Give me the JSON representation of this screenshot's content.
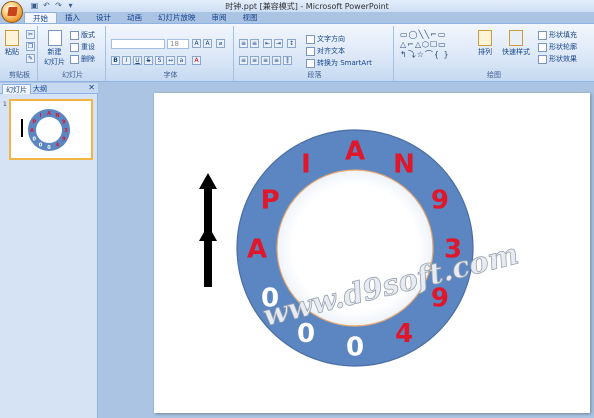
{
  "window": {
    "title": "时钟.ppt [兼容模式] - Microsoft PowerPoint"
  },
  "quick_access": [
    "save-icon",
    "undo-icon",
    "redo-icon",
    "customize-icon"
  ],
  "tabs": [
    {
      "label": "开始",
      "active": true
    },
    {
      "label": "插入",
      "active": false
    },
    {
      "label": "设计",
      "active": false
    },
    {
      "label": "动画",
      "active": false
    },
    {
      "label": "幻灯片放映",
      "active": false
    },
    {
      "label": "审阅",
      "active": false
    },
    {
      "label": "视图",
      "active": false
    }
  ],
  "ribbon": {
    "clipboard": {
      "label": "剪贴板",
      "paste": "粘贴"
    },
    "slides": {
      "label": "幻灯片",
      "new_slide": "新建\n幻灯片",
      "layout": "版式",
      "reset": "重设",
      "delete": "删除"
    },
    "font": {
      "label": "字体",
      "font_name": "",
      "font_size": "18"
    },
    "paragraph": {
      "label": "段落",
      "text_direction": "文字方向",
      "align_text": "对齐文本",
      "smartart": "转换为 SmartArt"
    },
    "drawing": {
      "label": "绘图",
      "arrange": "排列",
      "quick_styles": "快速样式",
      "shape_fill": "形状填充",
      "shape_outline": "形状轮廓",
      "shape_effects": "形状效果"
    }
  },
  "panel": {
    "tab_slides": "幻灯片",
    "tab_outline": "大纲",
    "slide_number": "1"
  },
  "slide": {
    "ring_letters": [
      {
        "char": "A",
        "color": "#e0162b"
      },
      {
        "char": "N",
        "color": "#e0162b"
      },
      {
        "char": "9",
        "color": "#e0162b"
      },
      {
        "char": "3",
        "color": "#e0162b"
      },
      {
        "char": "9",
        "color": "#e0162b"
      },
      {
        "char": "4",
        "color": "#e0162b"
      },
      {
        "char": "0",
        "color": "#ffffff"
      },
      {
        "char": "0",
        "color": "#ffffff"
      },
      {
        "char": "0",
        "color": "#ffffff"
      },
      {
        "char": "A",
        "color": "#e0162b"
      },
      {
        "char": "P",
        "color": "#e0162b"
      },
      {
        "char": "I",
        "color": "#e0162b"
      }
    ],
    "watermark": "www.d9soft.com",
    "ring_color": "#5b86c1",
    "ring_outline": "#4a6ea3"
  }
}
